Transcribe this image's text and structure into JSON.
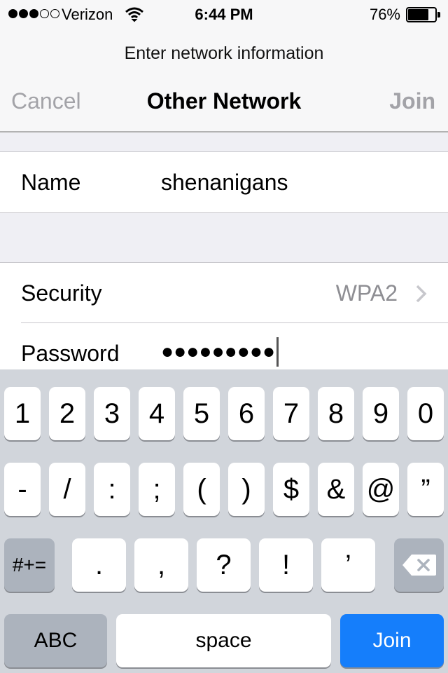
{
  "status_bar": {
    "signal_dots": 5,
    "signal_filled": 3,
    "carrier": "Verizon",
    "time": "6:44 PM",
    "battery_pct_label": "76%",
    "battery_level": 0.76
  },
  "nav": {
    "prompt": "Enter network information",
    "title": "Other Network",
    "cancel_label": "Cancel",
    "join_label": "Join"
  },
  "form": {
    "name_label": "Name",
    "name_value": "shenanigans",
    "security_label": "Security",
    "security_value": "WPA2",
    "password_label": "Password",
    "password_masked": "●●●●●●●●●"
  },
  "keyboard": {
    "row1": [
      "1",
      "2",
      "3",
      "4",
      "5",
      "6",
      "7",
      "8",
      "9",
      "0"
    ],
    "row2": [
      "-",
      "/",
      ":",
      ";",
      "(",
      ")",
      "$",
      "&",
      "@",
      "”"
    ],
    "row3_toggle": "#+=",
    "row3": [
      ".",
      ",",
      "?",
      "!",
      "’"
    ],
    "abc_label": "ABC",
    "space_label": "space",
    "join_label": "Join"
  },
  "colors": {
    "accent": "#157efb",
    "disabled_text": "#a3a3a8",
    "keyboard_bg": "#d1d5db"
  },
  "icons": [
    "wifi-icon",
    "battery-icon",
    "chevron-right-icon",
    "backspace-icon"
  ]
}
